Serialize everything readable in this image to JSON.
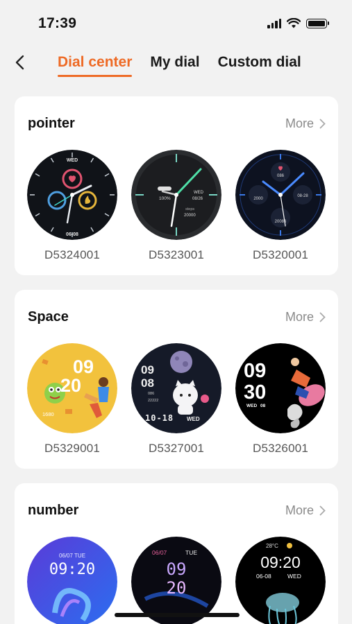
{
  "status_bar": {
    "time": "17:39"
  },
  "nav": {
    "tabs": [
      {
        "label": "Dial center",
        "active": true
      },
      {
        "label": "My dial",
        "active": false
      },
      {
        "label": "Custom dial",
        "active": false
      }
    ]
  },
  "sections": [
    {
      "title": "pointer",
      "more_label": "More",
      "dials": [
        {
          "id": "D5324001",
          "face_text": {
            "day": "WED",
            "date": "06-08"
          }
        },
        {
          "id": "D5323001",
          "face_text": {
            "battery": "100%",
            "day": "WED",
            "date": "08/26",
            "steps_label": "steps",
            "steps": "20000"
          }
        },
        {
          "id": "D5320001",
          "face_text": {
            "top": "086",
            "left": "2000",
            "right": "08-28",
            "bottom": "20086"
          }
        }
      ]
    },
    {
      "title": "Space",
      "more_label": "More",
      "dials": [
        {
          "id": "D5329001",
          "face_text": {
            "hour": "09",
            "minute": "20",
            "steps": "1680"
          }
        },
        {
          "id": "D5327001",
          "face_text": {
            "hour": "09",
            "minute": "08",
            "hr": "086",
            "steps": "22222",
            "date": "10-18",
            "day": "WED"
          }
        },
        {
          "id": "D5326001",
          "face_text": {
            "hour": "09",
            "minute": "30",
            "day": "WED",
            "date": "08"
          }
        }
      ]
    },
    {
      "title": "number",
      "more_label": "More",
      "dials": [
        {
          "id": "D5330001",
          "face_text": {
            "date": "06/07 TUE",
            "time": "09:20"
          }
        },
        {
          "id": "D5331001",
          "face_text": {
            "date": "06/07",
            "day": "TUE",
            "hour": "09",
            "minute": "20"
          }
        },
        {
          "id": "D5332001",
          "face_text": {
            "temp": "28°C",
            "time": "09:20",
            "date": "06-08",
            "day": "WED"
          }
        }
      ]
    }
  ],
  "colors": {
    "accent": "#ee6a25",
    "card": "#ffffff",
    "background": "#f2f2f2"
  }
}
